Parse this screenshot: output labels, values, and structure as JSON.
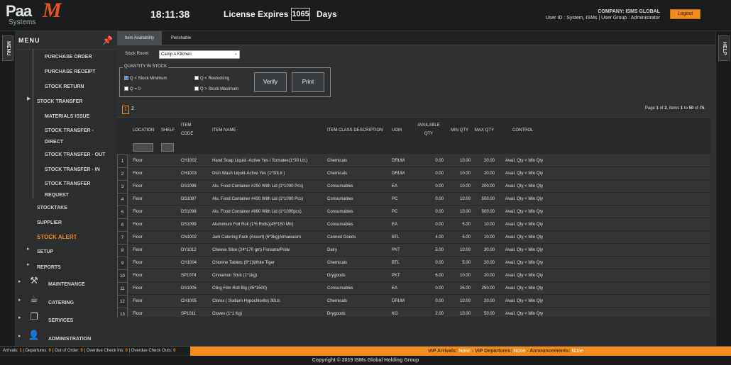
{
  "app": {
    "logo_main": "Paa",
    "logo_accent": "M",
    "logo_sub": "Systems"
  },
  "header": {
    "clock": "18:11:38",
    "license_label": "License Expires In",
    "license_days": "1065",
    "days_label": "Days",
    "company": "COMPANY: ISMS GLOBAL",
    "user_info": "User ID : System, ISMs | User Group : Administrator",
    "logout_label": "Logout"
  },
  "left_tab": {
    "label": "MENU"
  },
  "help_tab": {
    "label": "HELP"
  },
  "sidebar": {
    "title": "MENU",
    "items": [
      {
        "label": "PURCHASE ORDER"
      },
      {
        "label": "PURCHASE RECEIPT"
      },
      {
        "label": "STOCK RETURN"
      },
      {
        "label": "STOCK TRANSFER"
      },
      {
        "label": "MATERIALS ISSUE"
      },
      {
        "label": "STOCK TRANSFER -",
        "label2": "DIRECT"
      },
      {
        "label": "STOCK TRANSFER - OUT"
      },
      {
        "label": "STOCK TRANSFER - IN"
      },
      {
        "label": "STOCK TRANSFER",
        "label2": "REQUEST"
      },
      {
        "label": "STOCKTAKE"
      },
      {
        "label": "SUPPLIER"
      },
      {
        "label": "STOCK ALERT"
      },
      {
        "label": "SETUP"
      },
      {
        "label": "REPORTS"
      },
      {
        "label": "MAINTENANCE"
      },
      {
        "label": "CATERING"
      },
      {
        "label": "SERVICES"
      },
      {
        "label": "ADMINISTRATION"
      }
    ]
  },
  "tabs": [
    {
      "label": "Item Availability"
    },
    {
      "label": "Perishable"
    }
  ],
  "filters": {
    "stock_room_label": "Stock Room:",
    "stock_room_value": "Camp A Kitchen",
    "group_title": "QUANTITY IN STOCK",
    "options": [
      {
        "label": "Q < Stock Minimum",
        "checked": true
      },
      {
        "label": "Q < Restocking",
        "checked": false
      },
      {
        "label": "Q = 0",
        "checked": false
      },
      {
        "label": "Q > Stock Maximum",
        "checked": false
      }
    ],
    "verify_label": "Verify",
    "print_label": "Print"
  },
  "pagination": {
    "pages": [
      "1",
      "2"
    ],
    "info_prefix": "Page ",
    "page": "1",
    "of": " of ",
    "total_pages": "2",
    "items_text": ", items ",
    "from": "1",
    "to_text": " to ",
    "to": "50",
    "of2": " of ",
    "total": "75",
    "end": "."
  },
  "table": {
    "columns": {
      "location": "LOCATION",
      "shelf": "SHELF",
      "item_code_1": "ITEM",
      "item_code_2": "CODE",
      "item_name": "ITEM NAME",
      "item_class": "ITEM CLASS DESCRIPTION",
      "uom": "UOM",
      "available_1": "AVAILABLE",
      "available_2": "QTY",
      "min_qty": "MIN QTY",
      "max_qty": "MAX QTY",
      "control": "CONTROL"
    },
    "rows": [
      {
        "n": "1",
        "loc": "Floor",
        "code": "CH1002",
        "name": "Hand Soap Liquid -Active Yes / Somatex(1*30 Ltr.)",
        "cls": "Chemicals",
        "uom": "DRUM",
        "avail": "0.00",
        "min": "10.00",
        "max": "20.00",
        "ctrl": "Avail. Qty < Min Qty"
      },
      {
        "n": "2",
        "loc": "Floor",
        "code": "CH1003",
        "name": "Dish Wash Liquid-Active Yes (1*30Ltr.)",
        "cls": "Chemicals",
        "uom": "DRUM",
        "avail": "0.00",
        "min": "10.00",
        "max": "20.00",
        "ctrl": "Avail. Qty < Min Qty"
      },
      {
        "n": "3",
        "loc": "Floor",
        "code": "DS1096",
        "name": "Alu. Food Container #250 With Lid (1*1000 Pcs)",
        "cls": "Consumables",
        "uom": "EA",
        "avail": "0.00",
        "min": "10.00",
        "max": "200.00",
        "ctrl": "Avail. Qty < Min Qty"
      },
      {
        "n": "4",
        "loc": "Floor",
        "code": "DS1097",
        "name": "Alu. Food Container #420 With Lid (1*1000 Pcs)",
        "cls": "Consumables",
        "uom": "PC",
        "avail": "0.00",
        "min": "10.00",
        "max": "500.00",
        "ctrl": "Avail. Qty < Min Qty"
      },
      {
        "n": "5",
        "loc": "Floor",
        "code": "DS1098",
        "name": "Alu. Food Container #890 With Lid (1*1000pcs)",
        "cls": "Consumables",
        "uom": "PC",
        "avail": "0.00",
        "min": "10.00",
        "max": "500.00",
        "ctrl": "Avail. Qty < Min Qty"
      },
      {
        "n": "6",
        "loc": "Floor",
        "code": "DS1099",
        "name": "Aluminium Foil Roll (1*6 Rolls)(45*150 Mtr)",
        "cls": "Consumables",
        "uom": "EA",
        "avail": "0.00",
        "min": "5.00",
        "max": "10.00",
        "ctrl": "Avail. Qty < Min Qty"
      },
      {
        "n": "7",
        "loc": "Floor",
        "code": "CN1002",
        "name": "Jam Catering Pack (Assort) (6*3kg)Almawasim",
        "cls": "Canned Goods",
        "uom": "BTL",
        "avail": "4.00",
        "min": "5.00",
        "max": "10.00",
        "ctrl": "Avail. Qty < Min Qty"
      },
      {
        "n": "8",
        "loc": "Floor",
        "code": "DY1012",
        "name": "Cheese Slice (24*170 gm) Forsana/Pride",
        "cls": "Dairy",
        "uom": "PKT",
        "avail": "5.00",
        "min": "10.00",
        "max": "30.00",
        "ctrl": "Avail. Qty < Min Qty"
      },
      {
        "n": "9",
        "loc": "Floor",
        "code": "CH1004",
        "name": "Chlorine Tablets (6*1)White Tiger",
        "cls": "Chemicals",
        "uom": "BTL",
        "avail": "0.00",
        "min": "5.00",
        "max": "20.00",
        "ctrl": "Avail. Qty < Min Qty"
      },
      {
        "n": "10",
        "loc": "Floor",
        "code": "SP1074",
        "name": "Cinnamon Stick (1*1kg)",
        "cls": "Drygoods",
        "uom": "PKT",
        "avail": "6.00",
        "min": "10.00",
        "max": "20.00",
        "ctrl": "Avail. Qty < Min Qty"
      },
      {
        "n": "11",
        "loc": "Floor",
        "code": "DS1005",
        "name": "Cling Film Roll Big (45*1500)",
        "cls": "Consumables",
        "uom": "EA",
        "avail": "0.00",
        "min": "25.00",
        "max": "250.00",
        "ctrl": "Avail. Qty < Min Qty"
      },
      {
        "n": "12",
        "loc": "Floor",
        "code": "CH1005",
        "name": "Clorox ( Sodium Hypochlorite) 30Ltr.",
        "cls": "Chemicals",
        "uom": "DRUM",
        "avail": "0.00",
        "min": "10.00",
        "max": "20.00",
        "ctrl": "Avail. Qty < Min Qty"
      },
      {
        "n": "13",
        "loc": "Floor",
        "code": "SP1011",
        "name": "Cloves (1*1 Kg)",
        "cls": "Drygoods",
        "uom": "KG",
        "avail": "2.00",
        "min": "10.00",
        "max": "50.00",
        "ctrl": "Avail. Qty < Min Qty"
      }
    ]
  },
  "status": {
    "arrivals_label": "Arrivals: ",
    "arrivals": "1",
    "departures_label": " | Departures: ",
    "departures": "0",
    "ooo_label": " | Out of Order: ",
    "ooo": "0",
    "overdue_in_label": " | Overdue Check Ins: ",
    "overdue_in": "0",
    "overdue_out_label": " | Overdue Check Outs: ",
    "overdue_out": "0",
    "vip_arr_label": "VIP Arrivals: ",
    "vip_arr": "None",
    "vip_dep_label": " - VIP Departures: ",
    "vip_dep": "None",
    "ann_label": " - Announcements: ",
    "ann": "None"
  },
  "footer": {
    "copyright": "Copyright © 2019 ISMs Global Holding Group"
  },
  "colors": {
    "accent": "#f28c1c",
    "brand_red": "#e8531d",
    "background": "#2a2c2e"
  }
}
